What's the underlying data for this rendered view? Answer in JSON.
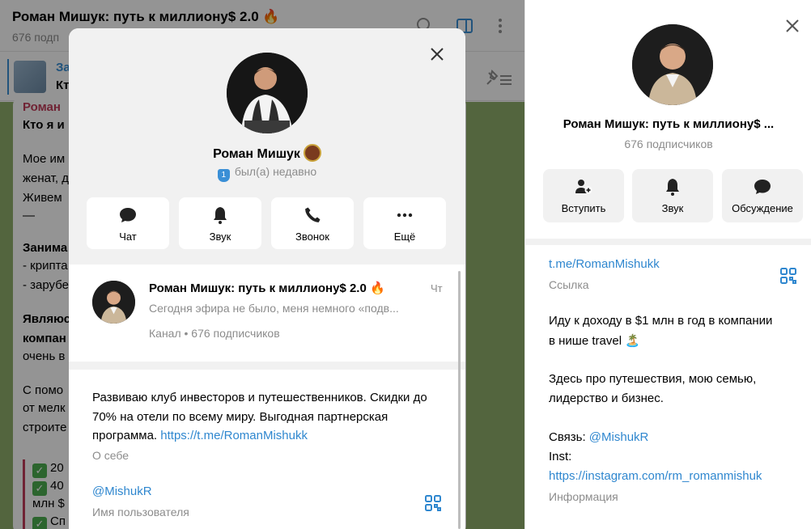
{
  "chat": {
    "title": "Роман Мишук: путь к миллиону$ 2.0 🔥",
    "subtitle": "676 подп",
    "pinned_title": "За",
    "pinned_text": "Кт",
    "author": "Роман",
    "lines": [
      {
        "text": "Кто я и",
        "bold": true
      },
      {
        "text": "Мое им",
        "bold": false
      },
      {
        "text": "женат, д",
        "bold": false
      },
      {
        "text": "Живем",
        "bold": false
      },
      {
        "text": "—",
        "bold": false
      },
      {
        "text": "Занима",
        "bold": true
      },
      {
        "text": "- крипта",
        "bold": false
      },
      {
        "text": "- зарубе",
        "bold": false
      },
      {
        "text": "Являюс",
        "bold": true
      },
      {
        "text": "компан",
        "bold": true
      },
      {
        "text": "очень в",
        "bold": false
      },
      {
        "text": "С помо",
        "bold": false
      },
      {
        "text": "от мелк",
        "bold": false
      },
      {
        "text": "строите",
        "bold": false
      }
    ],
    "quote_lines": [
      "20",
      "40",
      "млн $",
      "Сп"
    ]
  },
  "right_panel": {
    "name": "Роман Мишук: путь к миллиону$ ...",
    "subscribers": "676 подписчиков",
    "buttons": [
      {
        "label": "Вступить",
        "icon": "join-icon"
      },
      {
        "label": "Звук",
        "icon": "bell-icon"
      },
      {
        "label": "Обсуждение",
        "icon": "discussion-icon"
      }
    ],
    "link": "t.me/RomanMishukk",
    "link_label": "Ссылка",
    "info_lines": [
      "Иду к доходу в $1 млн в год в компании",
      "в нише travel 🏝️",
      "",
      "Здесь про путешествия, мою семью,",
      "лидерство и бизнес.",
      "",
      "Связь: @MishukR",
      "Inst:",
      "https://instagram.com/rm_romanmishuk"
    ],
    "contact_prefix": "Связь: ",
    "contact_handle": "@MishukR",
    "inst_label": "Inst:",
    "inst_link": "https://instagram.com/rm_romanmishuk",
    "info_label": "Информация"
  },
  "modal": {
    "name": "Роман Мишук",
    "status_badge": "1",
    "status": "был(а) недавно",
    "buttons": [
      {
        "label": "Чат",
        "icon": "chat-icon"
      },
      {
        "label": "Звук",
        "icon": "bell-icon"
      },
      {
        "label": "Звонок",
        "icon": "phone-icon"
      },
      {
        "label": "Ещё",
        "icon": "more-icon"
      }
    ],
    "channel": {
      "title": "Роман Мишук: путь к миллиону$ 2.0 🔥",
      "time": "Чт",
      "preview": "Сегодня эфира не было, меня немного «подв...",
      "meta": "Канал • 676 подписчиков"
    },
    "about_text": "Развиваю клуб инвесторов и путешественников. Скидки до 70% на отели по всему миру. Выгодная партнерская программа. ",
    "about_link": "https://t.me/RomanMishukk",
    "about_label": "О себе",
    "username": "@MishukR",
    "username_label": "Имя пользователя"
  },
  "colors": {
    "accent": "#2f87cf",
    "chat_bg": "#8fae6b"
  }
}
